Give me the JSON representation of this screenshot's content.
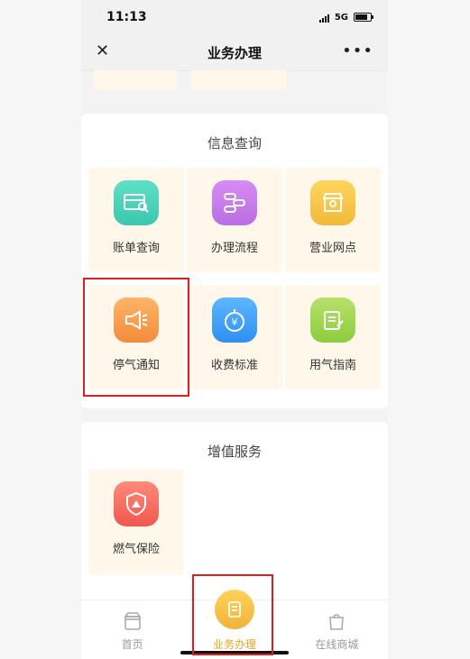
{
  "status": {
    "time": "11:13",
    "network": "5G"
  },
  "nav": {
    "title": "业务办理",
    "close_icon": "close-icon",
    "more_icon": "more-icon"
  },
  "sections": {
    "info": {
      "title": "信息查询",
      "items": [
        {
          "label": "账单查询",
          "icon": "bill-icon",
          "color": "#3cc6b0"
        },
        {
          "label": "办理流程",
          "icon": "flow-icon",
          "color": "#b96ee3"
        },
        {
          "label": "营业网点",
          "icon": "store-icon",
          "color": "#f2b93b"
        },
        {
          "label": "停气通知",
          "icon": "megaphone-icon",
          "color": "#f28c3a"
        },
        {
          "label": "收费标准",
          "icon": "stopwatch-yuan-icon",
          "color": "#2f8ff2"
        },
        {
          "label": "用气指南",
          "icon": "notepad-icon",
          "color": "#8ccd3f"
        }
      ]
    },
    "value_added": {
      "title": "增值服务",
      "items": [
        {
          "label": "燃气保险",
          "icon": "shield-icon",
          "color": "#f0584e"
        }
      ]
    }
  },
  "tabbar": {
    "items": [
      {
        "label": "首页",
        "icon": "home-icon"
      },
      {
        "label": "业务办理",
        "icon": "business-icon",
        "active": true
      },
      {
        "label": "在线商城",
        "icon": "shopping-bag-icon"
      }
    ]
  },
  "colors": {
    "accent": "#f2a020",
    "highlight": "#e01e1e",
    "tile_bg": "#fff7ea"
  }
}
